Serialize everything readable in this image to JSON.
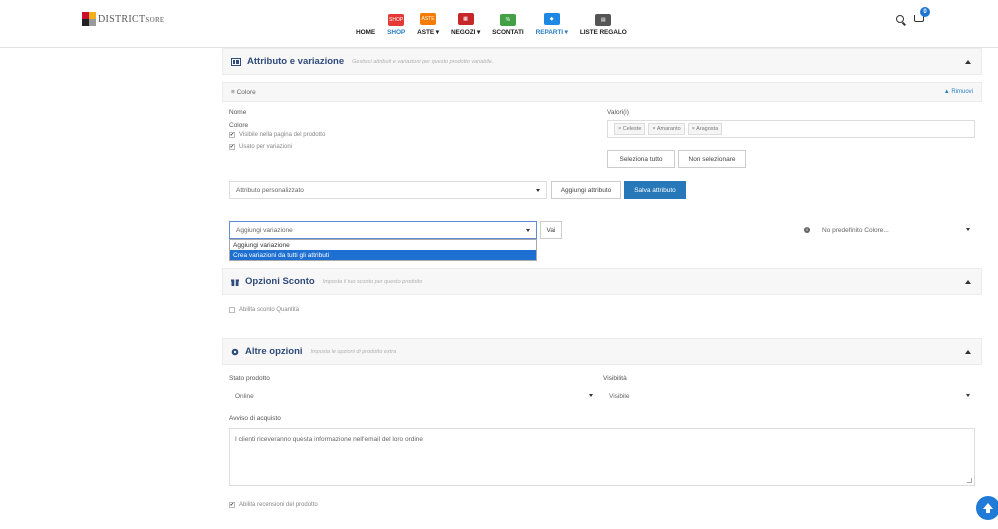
{
  "logo": {
    "text_main": "DISTRICT",
    "text_small": "SORE"
  },
  "nav": {
    "items": [
      {
        "label": "HOME",
        "icon": "none",
        "color": "",
        "blue": false
      },
      {
        "label": "SHOP",
        "icon": "shop-icon",
        "color": "#e53935",
        "badge": "SHOP",
        "blue": true
      },
      {
        "label": "ASTE ▾",
        "icon": "auction-icon",
        "color": "#f57c00",
        "badge": "ASTE",
        "blue": false
      },
      {
        "label": "NEGOZI ▾",
        "icon": "store-icon",
        "color": "#c62828",
        "badge": "▦",
        "blue": false
      },
      {
        "label": "SCONTATI",
        "icon": "discount-icon",
        "color": "#43a047",
        "badge": "%",
        "blue": false
      },
      {
        "label": "REPARTI ▾",
        "icon": "departments-icon",
        "color": "#1e88e5",
        "badge": "◆",
        "blue": true
      },
      {
        "label": "LISTE REGALO",
        "icon": "giftlist-icon",
        "color": "#555555",
        "badge": "▤",
        "blue": false
      }
    ],
    "cart_count": "0"
  },
  "attributes_panel": {
    "title": "Attributo e variazione",
    "subtitle": "Gestisci attributi e variazioni per questo prodotto variabile."
  },
  "color_attr": {
    "header": "≡ Colore",
    "remove": "▲ Rimuovi",
    "name_label": "Nome",
    "name_value": "Colore",
    "values_label": "Valori(i)",
    "values": [
      "× Celeste",
      "× Amaranto",
      "× Aragosta"
    ],
    "visible_label": "Visibile nella pagina del prodotto",
    "used_label": "Usato per variazioni",
    "select_all": "Seleziona tutto",
    "select_none": "Non selezionare"
  },
  "custom_attr": {
    "select_value": "Attributo personalizzato",
    "add_button": "Aggiungi attributo",
    "save_button": "Salva attributo"
  },
  "variation": {
    "select_value": "Aggiungi variazione",
    "go_button": "Vai",
    "default_select": "No predefinito Colore...",
    "options": [
      "Aggiungi variazione",
      "Crea variazioni da tutti gli attributi"
    ]
  },
  "discount_panel": {
    "title": "Opzioni Sconto",
    "subtitle": "Imposta il tuo sconto per questo prodotto",
    "qty_label": "Abilita sconto Quantità"
  },
  "other_panel": {
    "title": "Altre opzioni",
    "subtitle": "Imposta le opzioni di prodotto extra",
    "status_label": "Stato prodotto",
    "status_value": "Online",
    "visibility_label": "Visibilità",
    "visibility_value": "Visibile",
    "notice_label": "Avviso di acquisto",
    "notice_value": "I clienti riceveranno questa informazione nell'email del loro ordine",
    "reviews_label": "Abilita recensioni del prodotto"
  },
  "colors": {
    "accent": "#2678b9",
    "title": "#2f4b7c",
    "selection": "#1e6fd2"
  }
}
